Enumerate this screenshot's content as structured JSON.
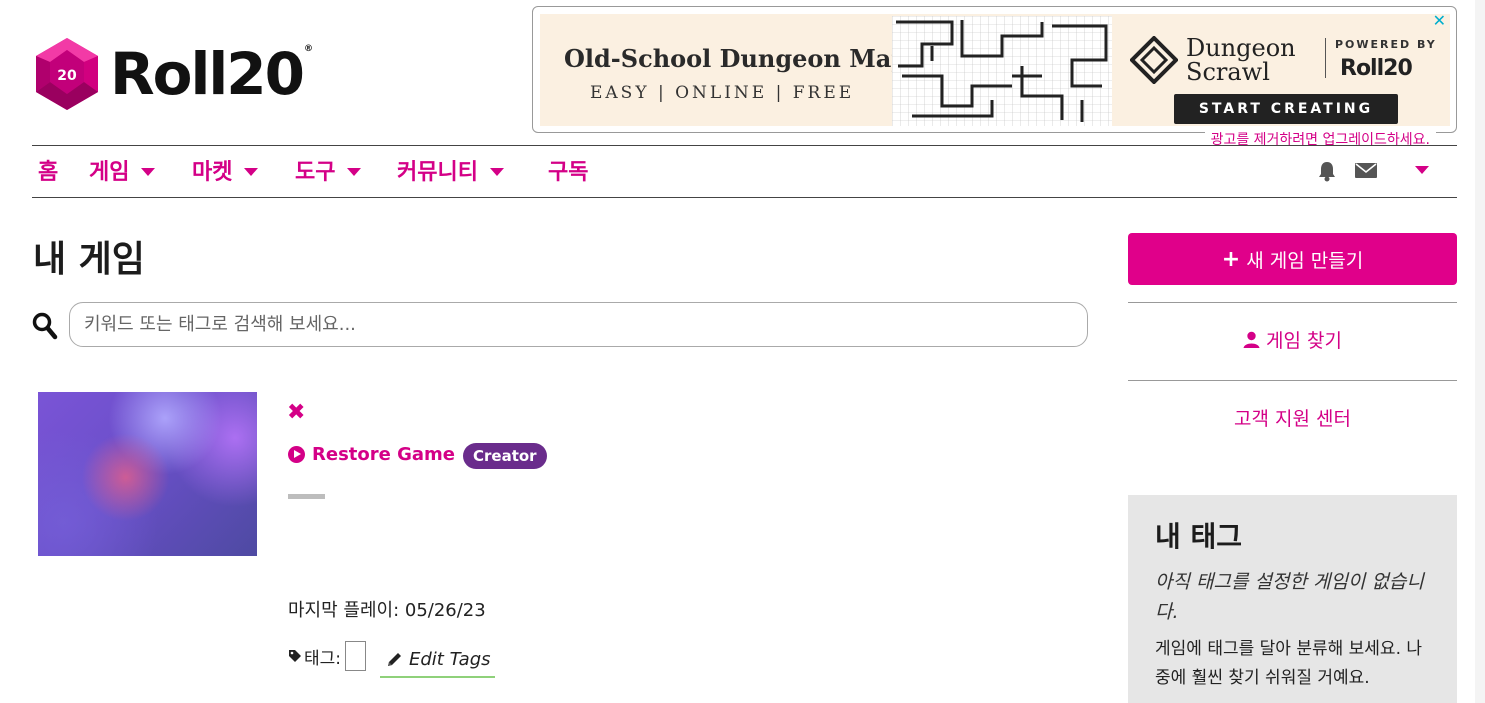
{
  "brand": {
    "name": "Roll20",
    "accent": "#e0008a",
    "d20_label": "20"
  },
  "ad": {
    "headline": "Old-School Dungeon Maps",
    "tagline": "EASY | ONLINE | FREE",
    "brand_line1": "Dungeon",
    "brand_line2": "Scrawl",
    "powered_by": "POWERED BY",
    "powered_brand": "Roll20",
    "cta": "START CREATING",
    "close": "✕",
    "remove_ads": "광고를 제거하려면 업그레이드하세요."
  },
  "nav": {
    "items": [
      {
        "label": "홈",
        "has_dropdown": false
      },
      {
        "label": "게임",
        "has_dropdown": true
      },
      {
        "label": "마켓",
        "has_dropdown": true
      },
      {
        "label": "도구",
        "has_dropdown": true
      },
      {
        "label": "커뮤니티",
        "has_dropdown": true
      },
      {
        "label": "구독",
        "has_dropdown": false
      }
    ],
    "right_icons": [
      "bell-icon",
      "envelope-icon",
      "chevron-down-icon"
    ]
  },
  "main": {
    "title": "내 게임",
    "search_placeholder": "키워드 또는 태그로 검색해 보세요...",
    "game": {
      "delete_glyph": "✖",
      "restore_label": "Restore Game",
      "role_badge": "Creator",
      "last_played": "마지막 플레이: 05/26/23",
      "tags_label": "태그:",
      "edit_tags_label": "Edit Tags"
    }
  },
  "sidebar": {
    "new_game_plus": "+",
    "new_game_label": "새 게임 만들기",
    "find_game_label": "게임 찾기",
    "support_label": "고객 지원 센터",
    "tags_title": "내 태그",
    "tags_empty": "아직 태그를 설정한 게임이 없습니다.",
    "tags_help": "게임에 태그를 달아 분류해 보세요. 나중에 훨씬 찾기 쉬워질 거예요."
  }
}
